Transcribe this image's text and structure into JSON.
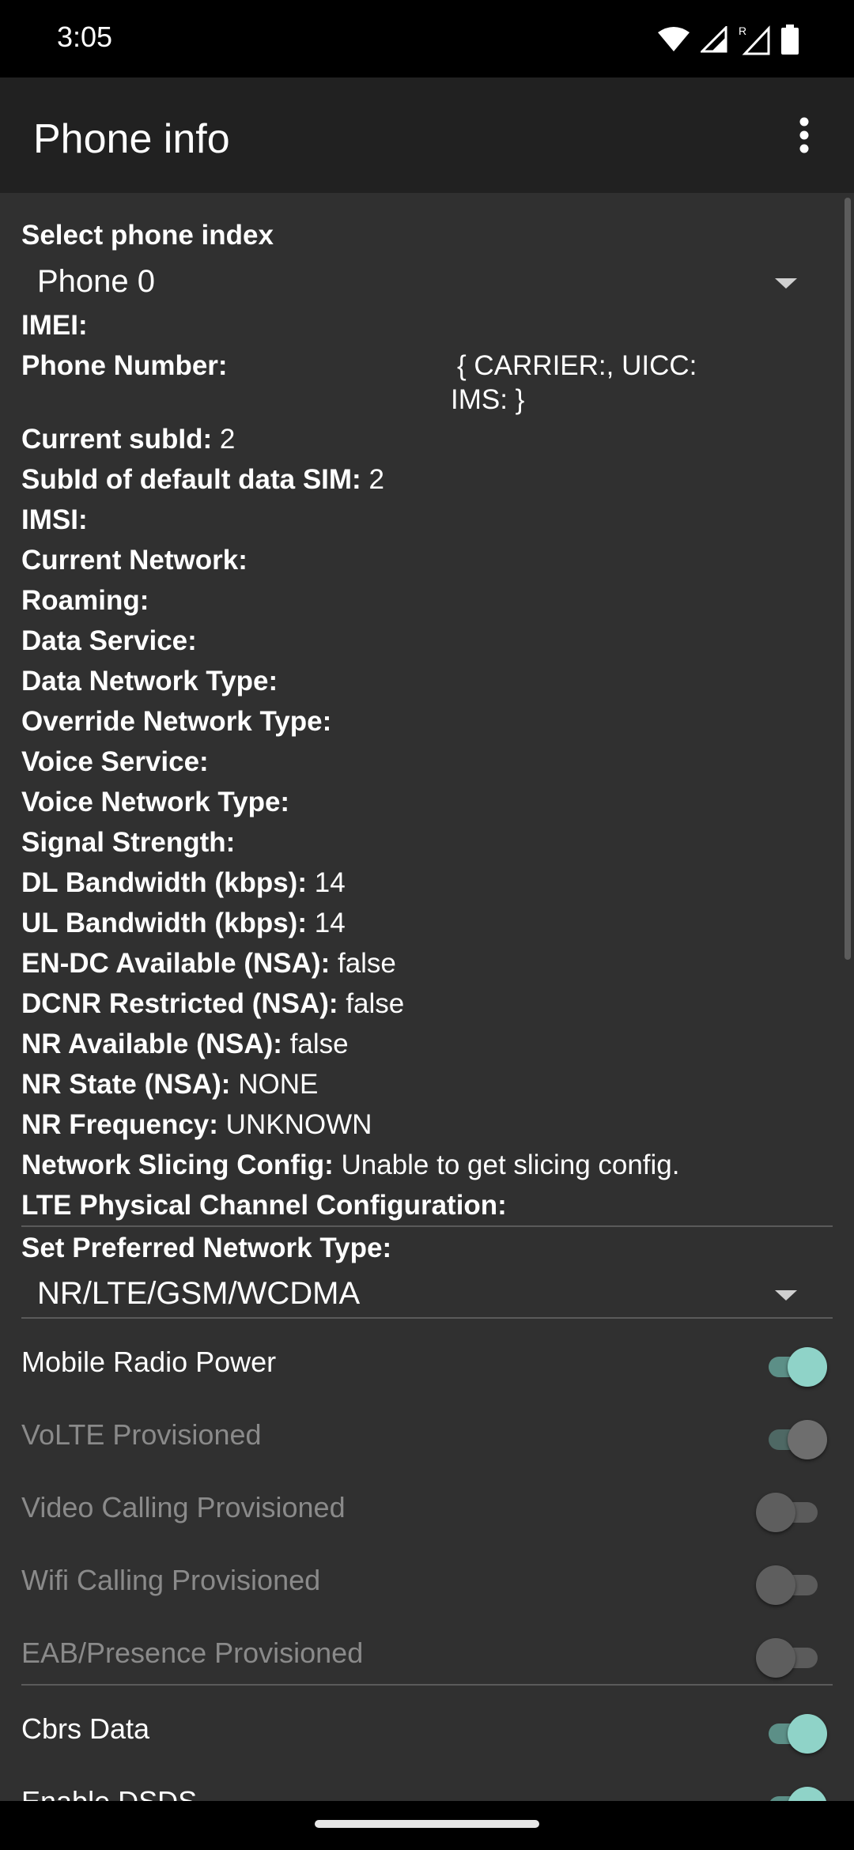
{
  "status": {
    "time": "3:05"
  },
  "app": {
    "title": "Phone info"
  },
  "phone_index": {
    "label": "Select phone index",
    "selected": "Phone 0"
  },
  "info": {
    "imei_label": "IMEI:",
    "phone_number_label": "Phone Number:",
    "phone_number_value_line1": "{ CARRIER:, UICC:",
    "phone_number_value_line2": " IMS: }",
    "current_subid_label": "Current subId:",
    "current_subid_value": "2",
    "default_data_label": "SubId of default data SIM:",
    "default_data_value": "2",
    "imsi_label": "IMSI:",
    "current_network_label": "Current Network:",
    "roaming_label": "Roaming:",
    "data_service_label": "Data Service:",
    "data_network_type_label": "Data Network Type:",
    "override_network_type_label": "Override Network Type:",
    "voice_service_label": "Voice Service:",
    "voice_network_type_label": "Voice Network Type:",
    "signal_strength_label": "Signal Strength:",
    "dl_bandwidth_label": "DL Bandwidth (kbps):",
    "dl_bandwidth_value": "14",
    "ul_bandwidth_label": "UL Bandwidth (kbps):",
    "ul_bandwidth_value": "14",
    "endc_label": "EN-DC Available (NSA):",
    "endc_value": "false",
    "dcnr_label": "DCNR Restricted (NSA):",
    "dcnr_value": "false",
    "nr_available_label": "NR Available (NSA):",
    "nr_available_value": "false",
    "nr_state_label": "NR State (NSA):",
    "nr_state_value": "NONE",
    "nr_frequency_label": "NR Frequency:",
    "nr_frequency_value": "UNKNOWN",
    "slicing_label": "Network Slicing Config:",
    "slicing_value": "Unable to get slicing config.",
    "lte_channel_label": "LTE Physical Channel Configuration:"
  },
  "preferred_network": {
    "label": "Set Preferred Network Type:",
    "selected": "NR/LTE/GSM/WCDMA"
  },
  "toggles": [
    {
      "label": "Mobile Radio Power",
      "state": "on",
      "enabled": true
    },
    {
      "label": "VoLTE Provisioned",
      "state": "on",
      "enabled": false
    },
    {
      "label": "Video Calling Provisioned",
      "state": "off",
      "enabled": false
    },
    {
      "label": "Wifi Calling Provisioned",
      "state": "off",
      "enabled": false
    },
    {
      "label": "EAB/Presence Provisioned",
      "state": "off",
      "enabled": false
    },
    {
      "label": "Cbrs Data",
      "state": "on",
      "enabled": true
    },
    {
      "label": "Enable DSDS",
      "state": "on",
      "enabled": true
    }
  ],
  "colors": {
    "background": "#303030",
    "app_bar": "#212121",
    "accent": "#8fd3c8"
  }
}
